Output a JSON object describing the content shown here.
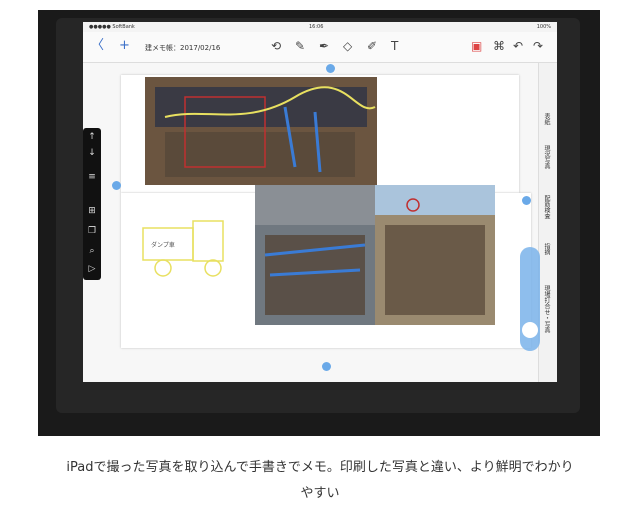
{
  "statusbar": {
    "carrier": "●●●●● SoftBank",
    "time": "16:06",
    "battery": "100%"
  },
  "toolbar": {
    "title": "建メモ帳：2017/02/16",
    "back_icon": "back-icon",
    "add_icon": "plus-icon"
  },
  "tools": [
    "lasso-icon",
    "pen-icon",
    "marker-icon",
    "eraser-icon",
    "highlighter-icon",
    "text-icon"
  ],
  "side_tabs": [
    "表紙",
    "現況写真",
    "配筋検査",
    "指摘",
    "現場打合せ・写真"
  ],
  "sketch_label": "ダンプ車",
  "caption": {
    "line1": "iPadで撮った写真を取り込んで手書きでメモ。印刷した写真と違い、より鮮明でわかり",
    "line2": "やすい"
  }
}
